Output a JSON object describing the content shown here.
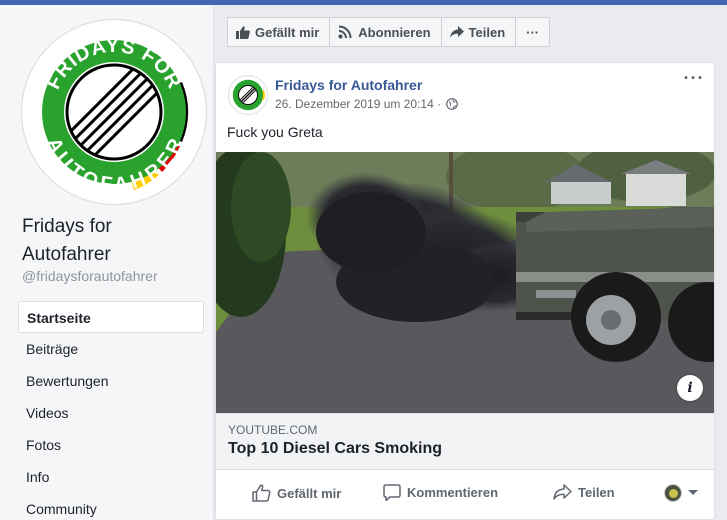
{
  "page": {
    "name": "Fridays for Autofahrer",
    "handle": "@fridaysforautofahrer",
    "logo_text_top": "FRIDAYS FOR",
    "logo_text_bottom": "AUTOFAHRER",
    "logo_colors": {
      "green": "#2aa32e",
      "black": "#000000",
      "red": "#dd0000",
      "gold": "#ffce00"
    }
  },
  "nav": {
    "items": [
      {
        "label": "Startseite",
        "active": true
      },
      {
        "label": "Beiträge"
      },
      {
        "label": "Bewertungen"
      },
      {
        "label": "Videos"
      },
      {
        "label": "Fotos"
      },
      {
        "label": "Info"
      },
      {
        "label": "Community"
      }
    ]
  },
  "actionbar": {
    "like_label": "Gefällt mir",
    "subscribe_label": "Abonnieren",
    "share_label": "Teilen",
    "more_label": "···"
  },
  "post": {
    "author": "Fridays for Autofahrer",
    "timestamp": "26. Dezember 2019 um 20:14 ·",
    "visibility_icon": "globe-icon",
    "more_label": "···",
    "text": "Fuck you Greta",
    "link": {
      "domain": "YOUTUBE.COM",
      "title": "Top 10 Diesel Cars Smoking"
    },
    "info_label": "i",
    "actions": {
      "like": "Gefällt mir",
      "comment": "Kommentieren",
      "share": "Teilen"
    }
  },
  "colors": {
    "facebook_blue": "#4267b2",
    "link_blue": "#385898"
  }
}
